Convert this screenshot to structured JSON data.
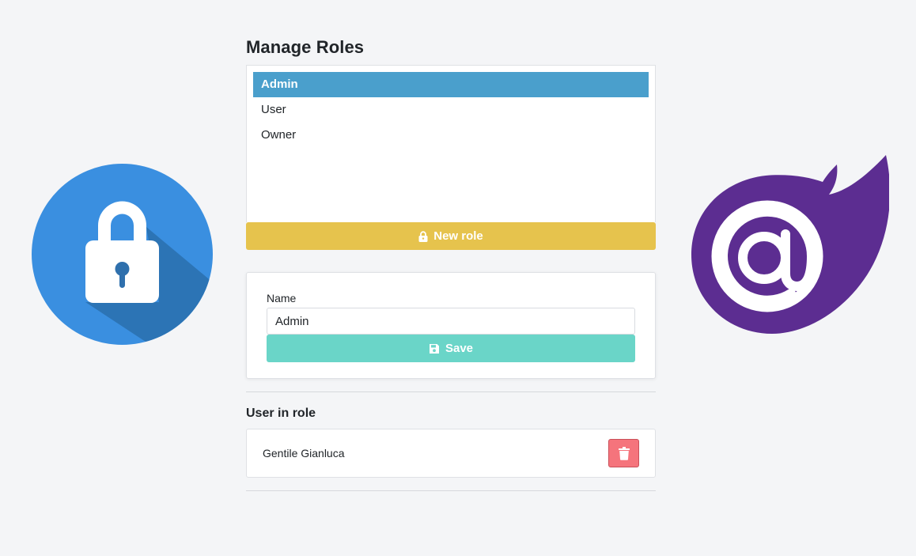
{
  "header": {
    "title": "Manage Roles"
  },
  "roles": {
    "items": [
      {
        "label": "Admin",
        "selected": true
      },
      {
        "label": "User",
        "selected": false
      },
      {
        "label": "Owner",
        "selected": false
      }
    ],
    "new_role_label": "New role"
  },
  "editor": {
    "name_label": "Name",
    "name_value": "Admin",
    "save_label": "Save"
  },
  "users_in_role": {
    "title": "User in role",
    "users": [
      {
        "name": "Gentile Gianluca"
      }
    ]
  },
  "icons": {
    "lock_logo": "lock-icon",
    "blazor_logo": "blazor-logo-icon",
    "new_role_icon": "lock-icon",
    "save_icon": "floppy-disk-icon",
    "delete_icon": "trash-icon"
  },
  "colors": {
    "selected_role": "#4a9fcc",
    "new_role_button": "#e6c34d",
    "save_button": "#6ad5c8",
    "delete_button": "#f5747c",
    "lock_circle": "#3b8fde",
    "blazor_purple": "#5c2d91"
  }
}
